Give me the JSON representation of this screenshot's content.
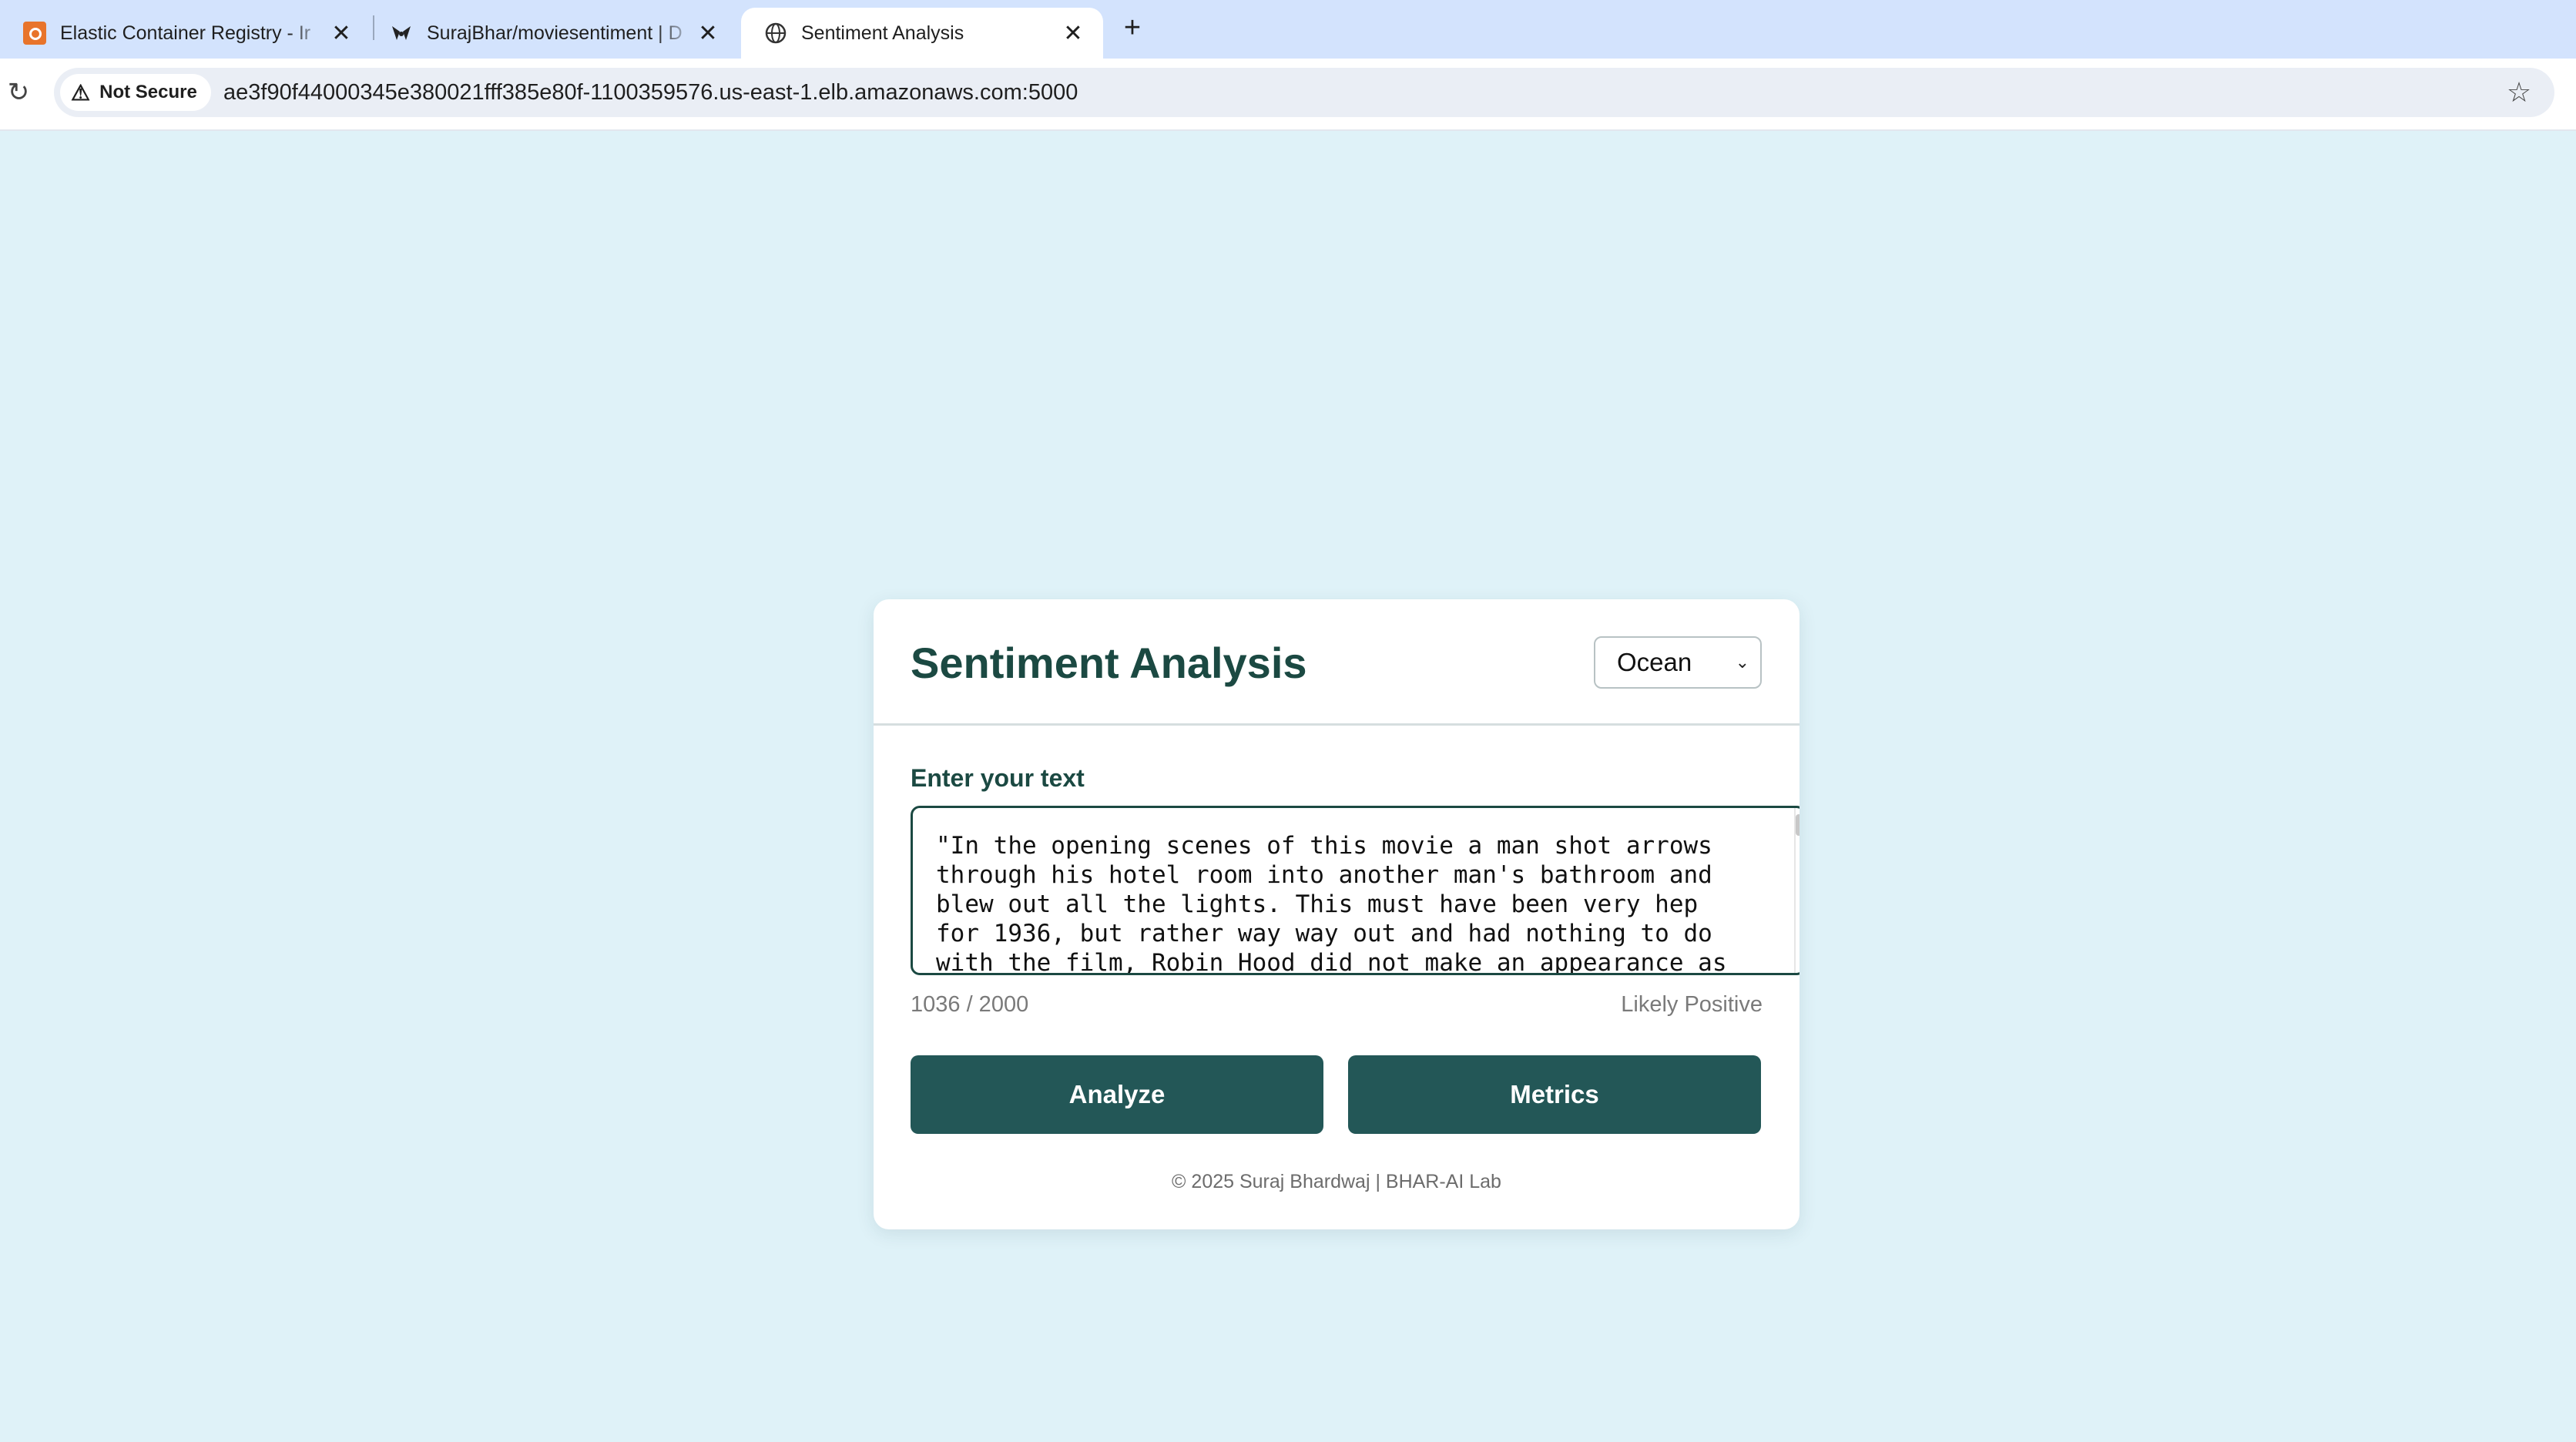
{
  "browser": {
    "tabs": [
      {
        "title": "Elastic Container Registry - Ir",
        "favicon": "aws-ecr-icon",
        "active": false
      },
      {
        "title": "SurajBhar/moviesentiment | D",
        "favicon": "dagshub-icon",
        "active": false
      },
      {
        "title": "Sentiment Analysis",
        "favicon": "globe-icon",
        "active": true
      }
    ],
    "security_label": "Not Secure",
    "url": "ae3f90f44000345e380021fff385e80f-1100359576.us-east-1.elb.amazonaws.com:5000"
  },
  "page": {
    "title": "Sentiment Analysis",
    "theme_select": {
      "selected": "Ocean"
    },
    "input_label": "Enter your text",
    "input_text": "\"In the opening scenes of this movie a man shot arrows through his hotel room into another man's bathroom and blew out all the lights. This must have been very hep for 1936, but rather way way out and had nothing to do with the film, Robin Hood did not make an appearance as",
    "char_count": "1036 / 2000",
    "prediction": "Likely Positive",
    "buttons": {
      "analyze": "Analyze",
      "metrics": "Metrics"
    },
    "footer": "© 2025 Suraj Bhardwaj | BHAR-AI Lab"
  },
  "colors": {
    "page_bg": "#dff2f8",
    "accent": "#235757",
    "title": "#1b4942"
  }
}
